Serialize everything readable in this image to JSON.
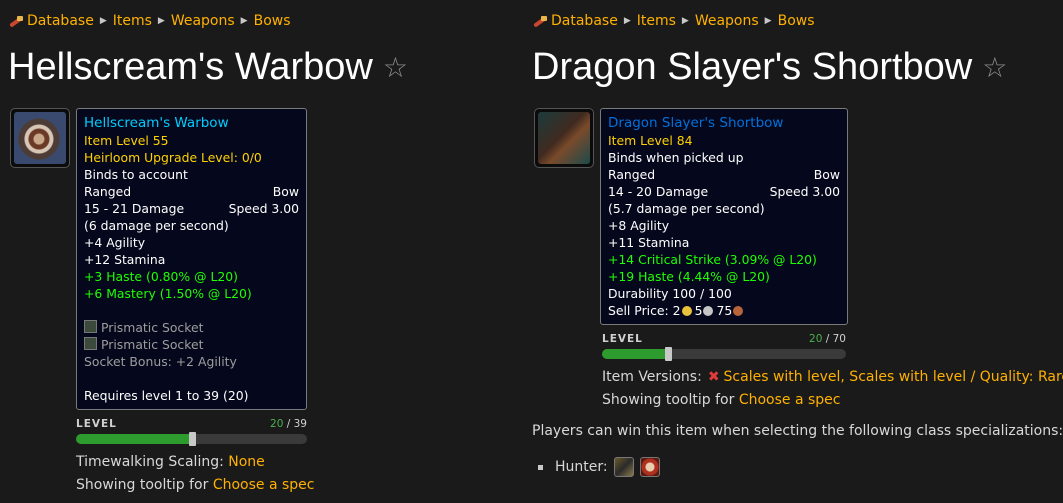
{
  "left": {
    "breadcrumb": [
      "Database",
      "Items",
      "Weapons",
      "Bows"
    ],
    "title": "Hellscream's Warbow",
    "tooltip": {
      "name": "Hellscream's Warbow",
      "item_level": "Item Level 55",
      "heirloom": "Heirloom Upgrade Level: 0/0",
      "binds": "Binds to account",
      "slot": "Ranged",
      "type": "Bow",
      "damage": "15 - 21 Damage",
      "speed": "Speed 3.00",
      "dps": "(6 damage per second)",
      "stat1": "+4 Agility",
      "stat2": "+12 Stamina",
      "green1": "+3 Haste (0.80% @ L20)",
      "green2": "+6 Mastery (1.50% @ L20)",
      "socket1": "Prismatic Socket",
      "socket2": "Prismatic Socket",
      "socket_bonus": "Socket Bonus: +2 Agility",
      "requires": "Requires level 1 to 39 (20)"
    },
    "level": {
      "label": "LEVEL",
      "current": "20",
      "max": "/ 39",
      "fraction": 0.5
    },
    "timewalking_label": "Timewalking Scaling:",
    "timewalking_value": "None",
    "showing_label": "Showing tooltip for",
    "showing_link": "Choose a spec"
  },
  "right": {
    "breadcrumb": [
      "Database",
      "Items",
      "Weapons",
      "Bows"
    ],
    "title": "Dragon Slayer's Shortbow",
    "tooltip": {
      "name": "Dragon Slayer's Shortbow",
      "item_level": "Item Level 84",
      "binds": "Binds when picked up",
      "slot": "Ranged",
      "type": "Bow",
      "damage": "14 - 20 Damage",
      "speed": "Speed 3.00",
      "dps": "(5.7 damage per second)",
      "stat1": "+8 Agility",
      "stat2": "+11 Stamina",
      "green1": "+14 Critical Strike (3.09% @ L20)",
      "green2": "+19 Haste (4.44% @ L20)",
      "durability": "Durability 100 / 100",
      "sell_label": "Sell Price:",
      "gold": "2",
      "silver": "5",
      "copper": "75"
    },
    "level": {
      "label": "LEVEL",
      "current": "20",
      "max": "/ 70",
      "fraction": 0.2714
    },
    "versions_label": "Item Versions:",
    "versions_value": "Scales with level, Scales with level / Quality: Rare",
    "showing_label": "Showing tooltip for",
    "showing_link": "Choose a spec",
    "players_text": "Players can win this item when selecting the following class specializations:",
    "class_label": "Hunter:"
  },
  "colors": {
    "link": "#ffb100",
    "item_name_heirloom": "#00ccff",
    "item_name_rare": "#0070dd",
    "item_level": "#ffd100",
    "bonus": "#1eff00",
    "bar_fill": "#2e9b2e",
    "gold_coin": "#e8c23a",
    "silver_coin": "#c6c6c6",
    "copper_coin": "#b8643a"
  },
  "icons": {
    "star": "favorite-star-icon",
    "home": "database-home-icon",
    "remove": "red-x-icon"
  }
}
